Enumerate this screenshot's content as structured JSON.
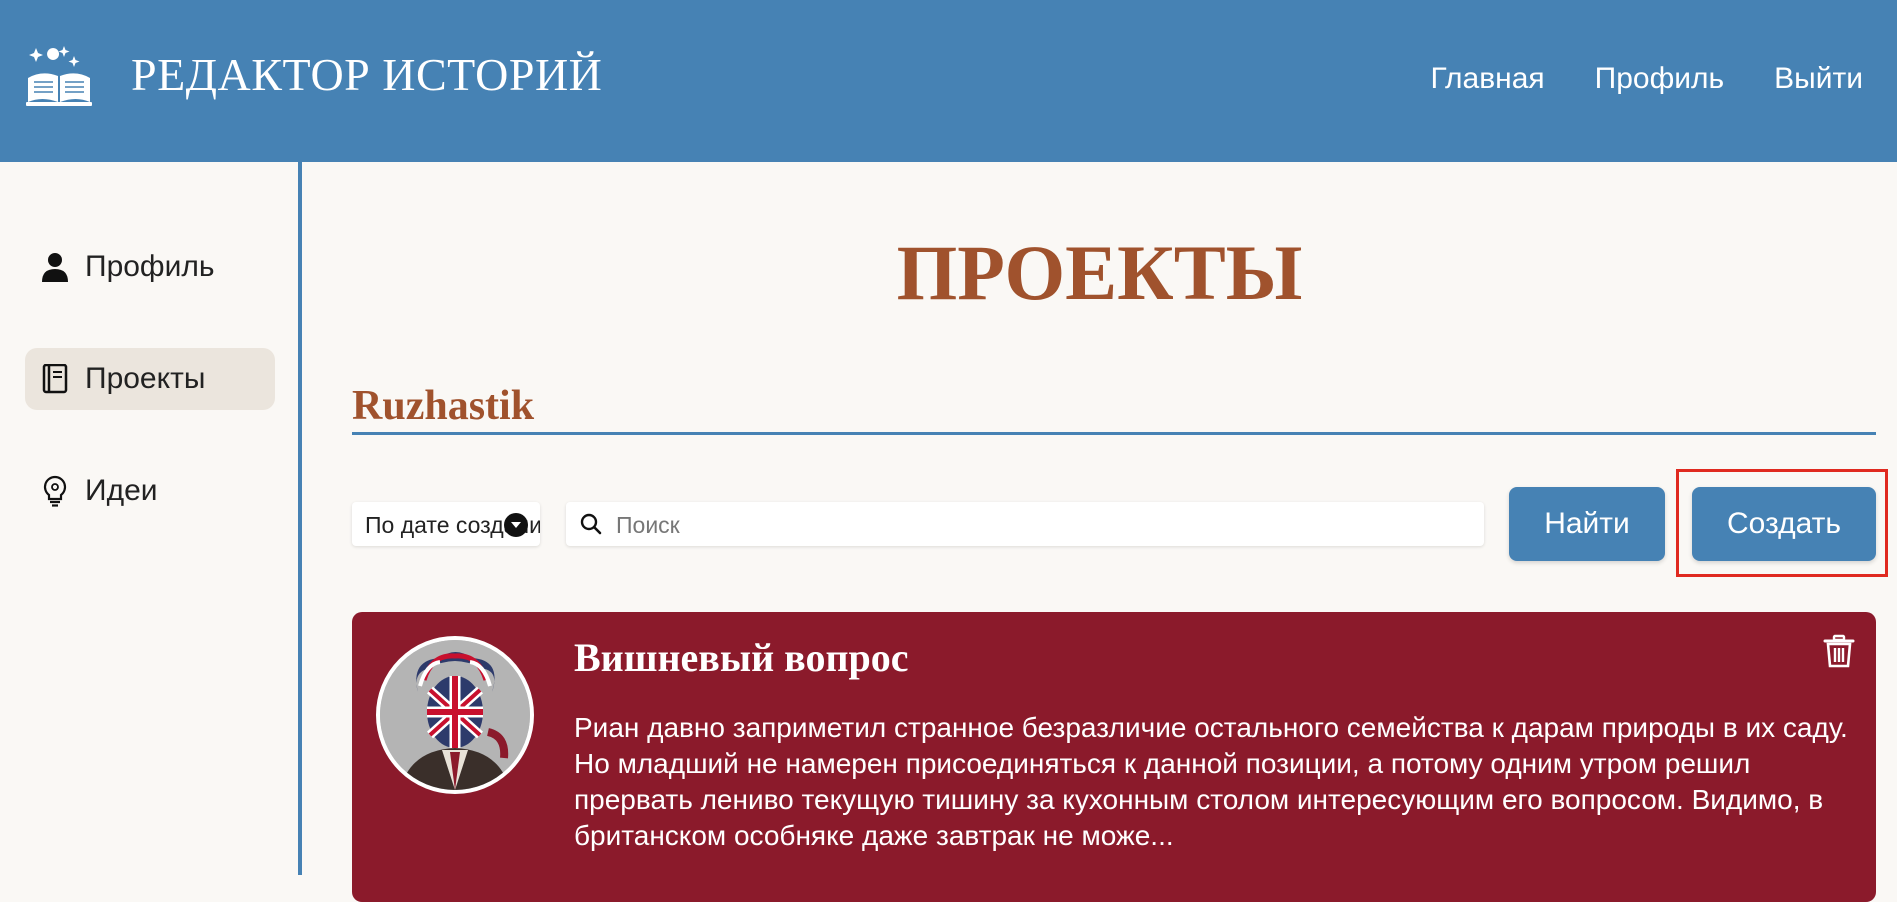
{
  "header": {
    "app_title": "РЕДАКТОР ИСТОРИЙ",
    "logo_icon": "open-book-sparkles-icon",
    "nav": [
      {
        "label": "Главная"
      },
      {
        "label": "Профиль"
      },
      {
        "label": "Выйти"
      }
    ]
  },
  "sidebar": {
    "items": [
      {
        "label": "Профиль",
        "icon": "user-icon",
        "active": false
      },
      {
        "label": "Проекты",
        "icon": "book-icon",
        "active": true
      },
      {
        "label": "Идеи",
        "icon": "lightbulb-icon",
        "active": false
      }
    ]
  },
  "main": {
    "page_title": "ПРОЕКТЫ",
    "username": "Ruzhastik",
    "sort": {
      "selected": "По дате создания"
    },
    "search": {
      "placeholder": "Поиск",
      "value": ""
    },
    "find_label": "Найти",
    "create_label": "Создать",
    "projects": [
      {
        "title": "Вишневый вопрос",
        "description": "Риан давно заприметил странное безразличие остального семейства к дарам природы в их саду. Но младший не намерен присоединяться к данной позиции, а потому одним утром решил прервать лениво текущую тишину за кухонным столом интересующим его вопросом. Видимо, в британском особняке даже завтрак не може..."
      }
    ]
  },
  "colors": {
    "header": "#4682b4",
    "accent_title": "#a0522d",
    "card": "#8b1a2b",
    "background": "#faf8f5",
    "highlight": "#e02a20"
  }
}
